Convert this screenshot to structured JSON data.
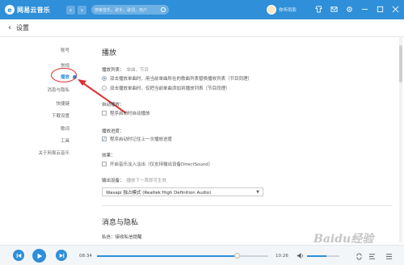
{
  "app": {
    "title": "网易云音乐",
    "logo_glyph": "e",
    "brand_color": "#2f8fd8"
  },
  "titlebar": {
    "search_placeholder": "搜索音乐，歌手，歌词，用户",
    "username": "你听雨影",
    "back_glyph": "‹",
    "forward_glyph": "›",
    "icons": [
      "skin-icon",
      "mail-icon",
      "settings-icon",
      "minimize-icon",
      "maximize-icon",
      "close-icon"
    ]
  },
  "header": {
    "back_glyph": "‹",
    "title": "设置"
  },
  "sidebar": {
    "items": [
      "账号",
      "常规",
      "播放",
      "消息与隐私",
      "快捷键",
      "下载设置",
      "歌词",
      "工具",
      "关于网易云音乐"
    ],
    "active_index": 2
  },
  "playback": {
    "title": "播放",
    "playlist_label": "播放列表：",
    "playlist_sub": "单曲，节目",
    "opt1": "双击播放单曲时，用当前单曲所在的歌曲列表替换播放列表（节目同理）",
    "opt2": "双击播放单曲时，仅把当前单曲添加到播放列表（节目同理）",
    "autoplay_label": "自动播放：",
    "autoplay_opt": "程序启动时自动播放",
    "progress_label": "播放进度：",
    "progress_opt": "程序启动时记住上一次播放进度",
    "effect_label": "效果：",
    "effect_opt": "开启音乐淡入淡出（仅支持输出设备DirectSound）",
    "device_label": "输出设备：",
    "device_sub": "播放下一首即可生效",
    "device_value": "Wasapi 独占模式 (Realtek High Definition Audio)",
    "device_options": [
      "Wasapi 独占模式 (Realtek High Definition Audio)"
    ]
  },
  "privacy": {
    "title": "消息与隐私",
    "private_msg_label": "私信：",
    "private_msg_value": "接收私信提醒"
  },
  "player": {
    "current_time": "08:34",
    "total_time": "10:26",
    "progress": 0.82,
    "volume": 0.6
  },
  "watermark": "Baidu经验"
}
